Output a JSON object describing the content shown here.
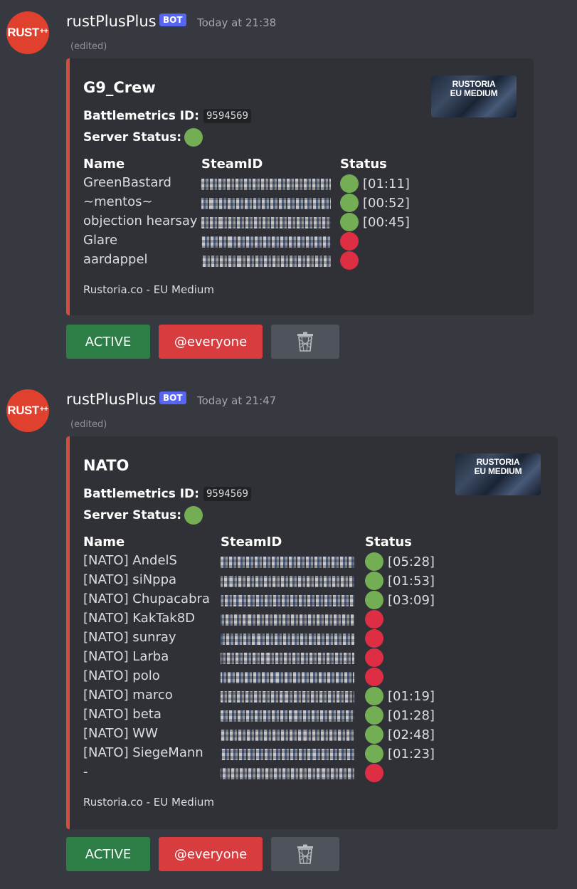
{
  "messages": [
    {
      "avatar_text": "RUST",
      "avatar_sup": "++",
      "username": "rustPlusPlus",
      "bot_tag": "BOT",
      "timestamp": "Today at 21:38",
      "edited": "(edited)",
      "embed": {
        "title": "G9_Crew",
        "thumbnail_text_1": "RUSTORIA",
        "thumbnail_text_2": "EU MEDIUM",
        "battlemetrics_label": "Battlemetrics ID:",
        "battlemetrics_id": "9594569",
        "server_status_label": "Server Status:",
        "server_status": "online",
        "headers": {
          "name": "Name",
          "steamid": "SteamID",
          "status": "Status"
        },
        "players": [
          {
            "name": "GreenBastard",
            "status": "online",
            "time": "[01:11]"
          },
          {
            "name": "~mentos~",
            "status": "online",
            "time": "[00:52]"
          },
          {
            "name": "objection hearsay",
            "status": "online",
            "time": "[00:45]"
          },
          {
            "name": "Glare",
            "status": "offline",
            "time": ""
          },
          {
            "name": "aardappel",
            "status": "offline",
            "time": ""
          }
        ],
        "footer": "Rustoria.co - EU Medium"
      },
      "buttons": {
        "active": "ACTIVE",
        "everyone": "@everyone"
      }
    },
    {
      "avatar_text": "RUST",
      "avatar_sup": "++",
      "username": "rustPlusPlus",
      "bot_tag": "BOT",
      "timestamp": "Today at 21:47",
      "edited": "(edited)",
      "embed": {
        "title": "NATO",
        "thumbnail_text_1": "RUSTORIA",
        "thumbnail_text_2": "EU MEDIUM",
        "battlemetrics_label": "Battlemetrics ID:",
        "battlemetrics_id": "9594569",
        "server_status_label": "Server Status:",
        "server_status": "online",
        "headers": {
          "name": "Name",
          "steamid": "SteamID",
          "status": "Status"
        },
        "players": [
          {
            "name": "[NATO] AndelS",
            "status": "online",
            "time": "[05:28]"
          },
          {
            "name": "[NATO] siNppa",
            "status": "online",
            "time": "[01:53]"
          },
          {
            "name": "[NATO] Chupacabra",
            "status": "online",
            "time": "[03:09]"
          },
          {
            "name": "[NATO] KakTak8D",
            "status": "offline",
            "time": ""
          },
          {
            "name": "[NATO] sunray",
            "status": "offline",
            "time": ""
          },
          {
            "name": "[NATO] Larba",
            "status": "offline",
            "time": ""
          },
          {
            "name": "[NATO] polo",
            "status": "offline",
            "time": ""
          },
          {
            "name": "[NATO] marco",
            "status": "online",
            "time": "[01:19]"
          },
          {
            "name": "[NATO] beta",
            "status": "online",
            "time": "[01:28]"
          },
          {
            "name": "[NATO] WW",
            "status": "online",
            "time": "[02:48]"
          },
          {
            "name": "[NATO] SiegeMann",
            "status": "online",
            "time": "[01:23]"
          },
          {
            "name": "-",
            "status": "offline",
            "time": ""
          }
        ],
        "footer": "Rustoria.co - EU Medium"
      },
      "buttons": {
        "active": "ACTIVE",
        "everyone": "@everyone"
      }
    }
  ],
  "icons": {
    "trash": "trash-icon",
    "status_online": "green-circle-icon",
    "status_offline": "red-circle-icon"
  },
  "colors": {
    "online": "#74ae54",
    "offline": "#dd2e44",
    "active_button": "#2d7d46",
    "everyone_button": "#d83c3e",
    "embed_border": "#d74b3a",
    "bot_tag": "#5865f2"
  }
}
